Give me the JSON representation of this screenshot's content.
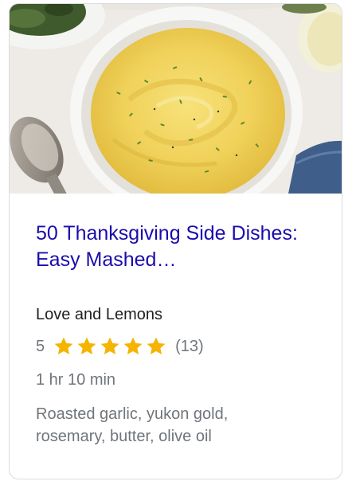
{
  "card": {
    "title": "50 Thanksgiving Side Dishes: Easy Mashed…",
    "source": "Love and Lemons",
    "rating": {
      "value": "5",
      "stars": 5,
      "stars_max": 5,
      "count": "(13)",
      "star_color": "#f4b400"
    },
    "time": "1 hr 10 min",
    "ingredients": "Roasted garlic, yukon gold, rosemary, butter, olive oil",
    "title_color": "#1a0dab"
  }
}
